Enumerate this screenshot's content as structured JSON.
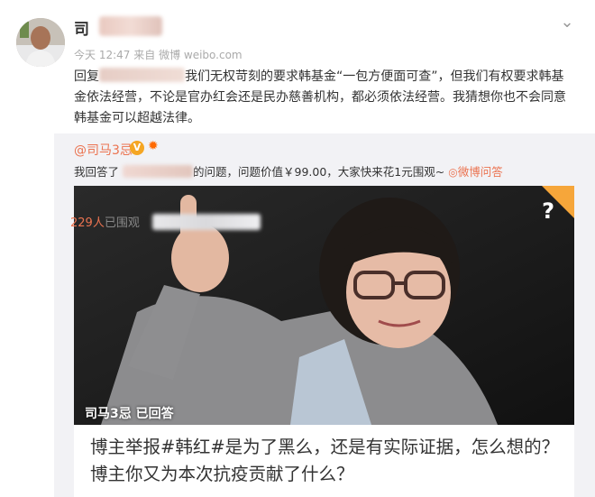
{
  "post": {
    "username": "司",
    "time": "今天 12:47",
    "source_prefix": "来自",
    "source": "微博 weibo.com",
    "reply_prefix": "回复",
    "reply_body": "我们无权苛刻的要求韩基金“一包方便面可查”，但我们有权要求韩基金依法经营，不论是官办红会还是民办慈善机构，都必须依法经营。我猜想你也不会同意韩基金可以超越法律。"
  },
  "quoted": {
    "username": "@司马3忌",
    "line_prefix": "我回答了",
    "line_suffix": "的问题，问题价值￥99.00，大家快来花1元围观~",
    "ask_link": "微博问答",
    "photo_label": "司马3忌 已回答",
    "question_mark": "?",
    "question": "博主举报#韩红#是为了黑么，还是有实际证据，怎么想的？博主你又为本次抗疫贡献了什么？",
    "view_count": "229人",
    "view_suffix": "已围观",
    "colors": {
      "accent": "#eb7350",
      "badge": "#f5a623",
      "corner": "#f6a63a"
    }
  },
  "icons": {
    "follow": "chevron-down-icon",
    "verified": "verified-v-icon",
    "fire": "fire-icon",
    "ask": "weibo-ask-icon"
  }
}
